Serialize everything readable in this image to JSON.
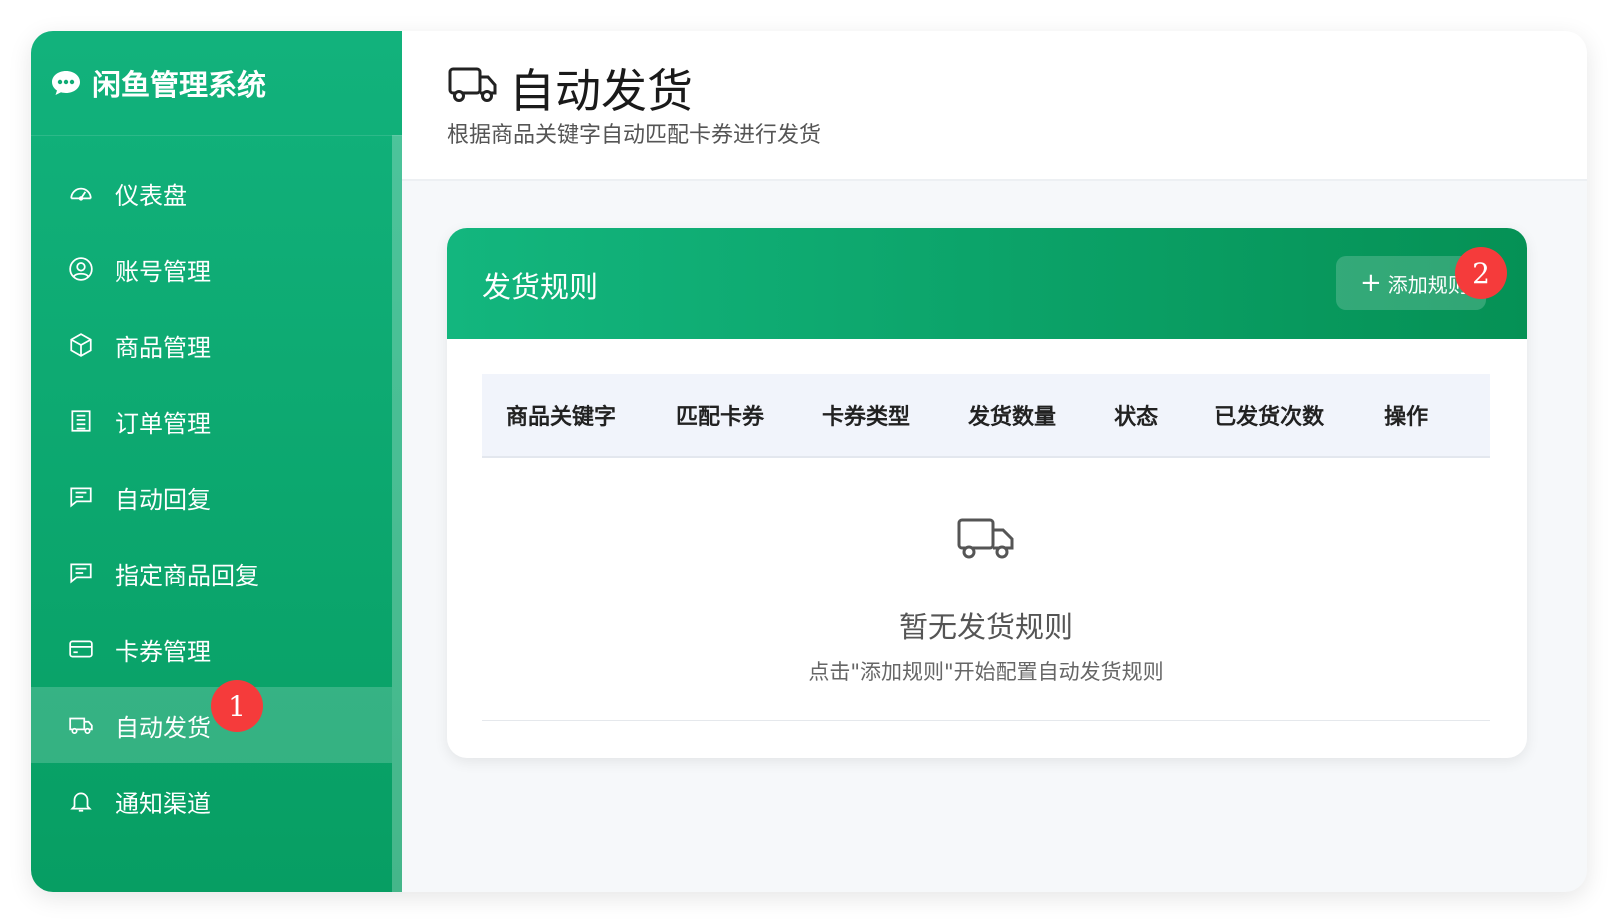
{
  "sidebar": {
    "brand_title": "闲鱼管理系统",
    "items": [
      {
        "label": "仪表盘",
        "icon": "dashboard-icon"
      },
      {
        "label": "账号管理",
        "icon": "user-icon"
      },
      {
        "label": "商品管理",
        "icon": "box-icon"
      },
      {
        "label": "订单管理",
        "icon": "order-icon"
      },
      {
        "label": "自动回复",
        "icon": "chat-icon"
      },
      {
        "label": "指定商品回复",
        "icon": "chat-icon"
      },
      {
        "label": "卡券管理",
        "icon": "card-icon"
      },
      {
        "label": "自动发货",
        "icon": "truck-icon",
        "active": true
      },
      {
        "label": "通知渠道",
        "icon": "bell-icon"
      }
    ]
  },
  "annotations": {
    "badge1": "1",
    "badge2": "2"
  },
  "header": {
    "title": "自动发货",
    "subtitle": "根据商品关键字自动匹配卡券进行发货"
  },
  "rules_card": {
    "title": "发货规则",
    "add_button": "添加规则",
    "columns": [
      "商品关键字",
      "匹配卡券",
      "卡券类型",
      "发货数量",
      "状态",
      "已发货次数",
      "操作"
    ],
    "empty_title": "暂无发货规则",
    "empty_desc": "点击\"添加规则\"开始配置自动发货规则"
  },
  "colors": {
    "brand_green": "#12b27c",
    "badge_red": "#f53b3b"
  }
}
